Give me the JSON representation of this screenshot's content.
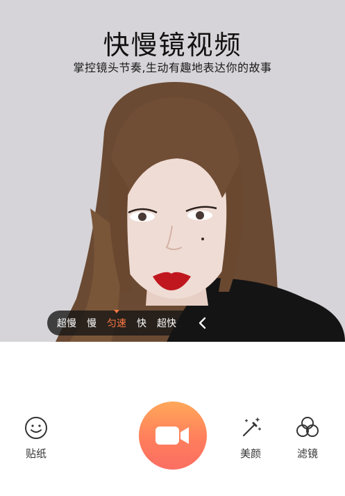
{
  "header": {
    "title": "快慢镜视频",
    "subtitle": "掌控镜头节奏,生动有趣地表达你的故事"
  },
  "speed_selector": {
    "options": [
      "超慢",
      "慢",
      "匀速",
      "快",
      "超快"
    ],
    "selected": "匀速",
    "collapse_icon": "chevron-left-icon"
  },
  "toolbar": {
    "sticker_label": "贴纸",
    "beauty_label": "美颜",
    "filter_label": "滤镜",
    "record_icon": "video-camera-icon"
  },
  "colors": {
    "accent": "#ff7a45",
    "record_gradient_top": "#ffa85a",
    "record_gradient_bottom": "#fb6e63"
  }
}
